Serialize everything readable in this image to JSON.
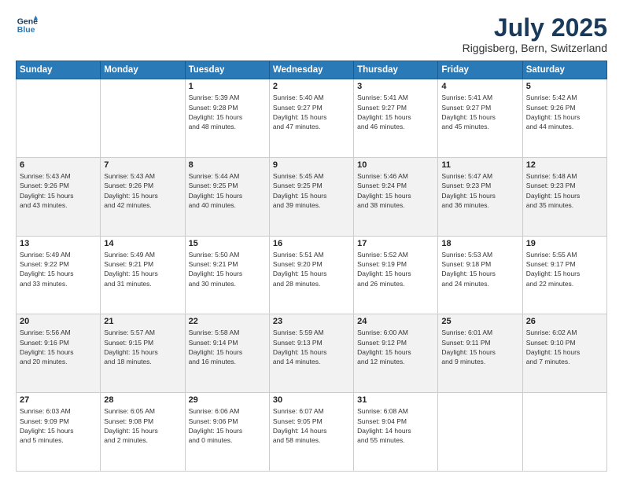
{
  "logo": {
    "line1": "General",
    "line2": "Blue"
  },
  "title": "July 2025",
  "subtitle": "Riggisberg, Bern, Switzerland",
  "weekdays": [
    "Sunday",
    "Monday",
    "Tuesday",
    "Wednesday",
    "Thursday",
    "Friday",
    "Saturday"
  ],
  "weeks": [
    [
      {
        "day": "",
        "info": ""
      },
      {
        "day": "",
        "info": ""
      },
      {
        "day": "1",
        "info": "Sunrise: 5:39 AM\nSunset: 9:28 PM\nDaylight: 15 hours\nand 48 minutes."
      },
      {
        "day": "2",
        "info": "Sunrise: 5:40 AM\nSunset: 9:27 PM\nDaylight: 15 hours\nand 47 minutes."
      },
      {
        "day": "3",
        "info": "Sunrise: 5:41 AM\nSunset: 9:27 PM\nDaylight: 15 hours\nand 46 minutes."
      },
      {
        "day": "4",
        "info": "Sunrise: 5:41 AM\nSunset: 9:27 PM\nDaylight: 15 hours\nand 45 minutes."
      },
      {
        "day": "5",
        "info": "Sunrise: 5:42 AM\nSunset: 9:26 PM\nDaylight: 15 hours\nand 44 minutes."
      }
    ],
    [
      {
        "day": "6",
        "info": "Sunrise: 5:43 AM\nSunset: 9:26 PM\nDaylight: 15 hours\nand 43 minutes."
      },
      {
        "day": "7",
        "info": "Sunrise: 5:43 AM\nSunset: 9:26 PM\nDaylight: 15 hours\nand 42 minutes."
      },
      {
        "day": "8",
        "info": "Sunrise: 5:44 AM\nSunset: 9:25 PM\nDaylight: 15 hours\nand 40 minutes."
      },
      {
        "day": "9",
        "info": "Sunrise: 5:45 AM\nSunset: 9:25 PM\nDaylight: 15 hours\nand 39 minutes."
      },
      {
        "day": "10",
        "info": "Sunrise: 5:46 AM\nSunset: 9:24 PM\nDaylight: 15 hours\nand 38 minutes."
      },
      {
        "day": "11",
        "info": "Sunrise: 5:47 AM\nSunset: 9:23 PM\nDaylight: 15 hours\nand 36 minutes."
      },
      {
        "day": "12",
        "info": "Sunrise: 5:48 AM\nSunset: 9:23 PM\nDaylight: 15 hours\nand 35 minutes."
      }
    ],
    [
      {
        "day": "13",
        "info": "Sunrise: 5:49 AM\nSunset: 9:22 PM\nDaylight: 15 hours\nand 33 minutes."
      },
      {
        "day": "14",
        "info": "Sunrise: 5:49 AM\nSunset: 9:21 PM\nDaylight: 15 hours\nand 31 minutes."
      },
      {
        "day": "15",
        "info": "Sunrise: 5:50 AM\nSunset: 9:21 PM\nDaylight: 15 hours\nand 30 minutes."
      },
      {
        "day": "16",
        "info": "Sunrise: 5:51 AM\nSunset: 9:20 PM\nDaylight: 15 hours\nand 28 minutes."
      },
      {
        "day": "17",
        "info": "Sunrise: 5:52 AM\nSunset: 9:19 PM\nDaylight: 15 hours\nand 26 minutes."
      },
      {
        "day": "18",
        "info": "Sunrise: 5:53 AM\nSunset: 9:18 PM\nDaylight: 15 hours\nand 24 minutes."
      },
      {
        "day": "19",
        "info": "Sunrise: 5:55 AM\nSunset: 9:17 PM\nDaylight: 15 hours\nand 22 minutes."
      }
    ],
    [
      {
        "day": "20",
        "info": "Sunrise: 5:56 AM\nSunset: 9:16 PM\nDaylight: 15 hours\nand 20 minutes."
      },
      {
        "day": "21",
        "info": "Sunrise: 5:57 AM\nSunset: 9:15 PM\nDaylight: 15 hours\nand 18 minutes."
      },
      {
        "day": "22",
        "info": "Sunrise: 5:58 AM\nSunset: 9:14 PM\nDaylight: 15 hours\nand 16 minutes."
      },
      {
        "day": "23",
        "info": "Sunrise: 5:59 AM\nSunset: 9:13 PM\nDaylight: 15 hours\nand 14 minutes."
      },
      {
        "day": "24",
        "info": "Sunrise: 6:00 AM\nSunset: 9:12 PM\nDaylight: 15 hours\nand 12 minutes."
      },
      {
        "day": "25",
        "info": "Sunrise: 6:01 AM\nSunset: 9:11 PM\nDaylight: 15 hours\nand 9 minutes."
      },
      {
        "day": "26",
        "info": "Sunrise: 6:02 AM\nSunset: 9:10 PM\nDaylight: 15 hours\nand 7 minutes."
      }
    ],
    [
      {
        "day": "27",
        "info": "Sunrise: 6:03 AM\nSunset: 9:09 PM\nDaylight: 15 hours\nand 5 minutes."
      },
      {
        "day": "28",
        "info": "Sunrise: 6:05 AM\nSunset: 9:08 PM\nDaylight: 15 hours\nand 2 minutes."
      },
      {
        "day": "29",
        "info": "Sunrise: 6:06 AM\nSunset: 9:06 PM\nDaylight: 15 hours\nand 0 minutes."
      },
      {
        "day": "30",
        "info": "Sunrise: 6:07 AM\nSunset: 9:05 PM\nDaylight: 14 hours\nand 58 minutes."
      },
      {
        "day": "31",
        "info": "Sunrise: 6:08 AM\nSunset: 9:04 PM\nDaylight: 14 hours\nand 55 minutes."
      },
      {
        "day": "",
        "info": ""
      },
      {
        "day": "",
        "info": ""
      }
    ]
  ]
}
